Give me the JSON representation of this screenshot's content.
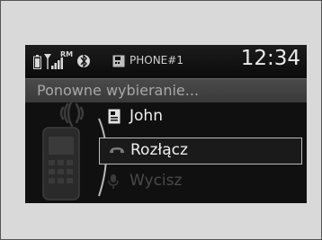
{
  "status": {
    "roaming": "RM",
    "phone_label": "PHONE#1",
    "time": "12:34"
  },
  "title": "Ponowne wybieranie...",
  "menu": {
    "contact": "John",
    "hangup": "Rozłącz",
    "mute": "Wycisz"
  },
  "icons": {
    "battery": "battery-icon",
    "signal": "signal-strength-icon",
    "bluetooth": "bluetooth-icon",
    "phone_device": "phone-device-icon",
    "contact": "contact-card-icon",
    "hangup": "hang-up-icon",
    "mute": "microphone-mute-icon"
  },
  "colors": {
    "screen_bg": "#101010",
    "title_bar": "#424242",
    "text": "#f0f0f0",
    "dim_text": "#4a4a4a"
  }
}
